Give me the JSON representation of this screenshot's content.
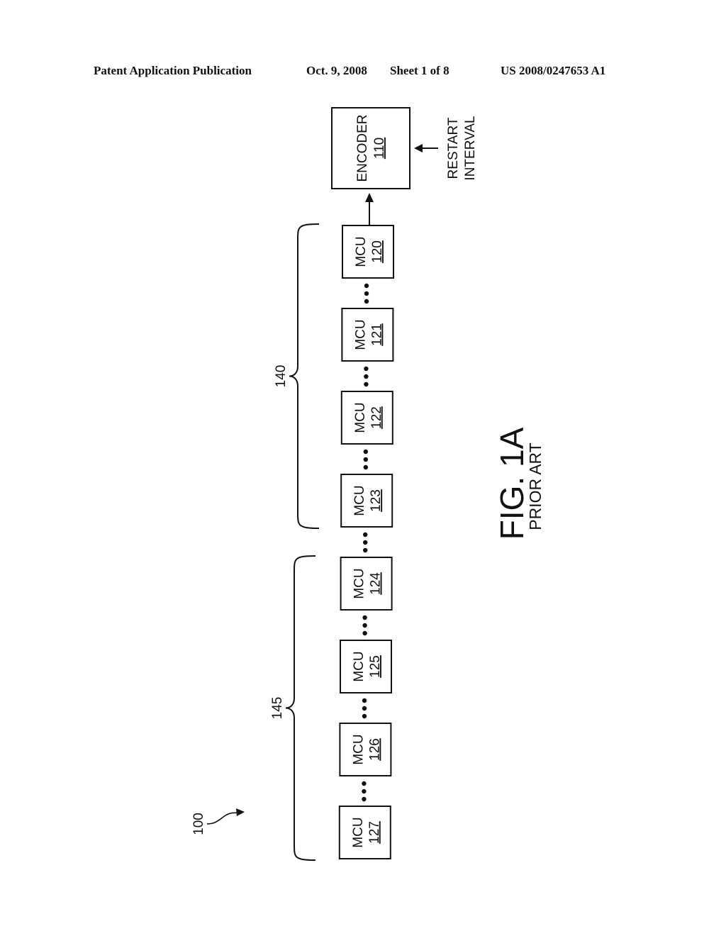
{
  "header": {
    "publication": "Patent Application Publication",
    "date": "Oct. 9, 2008",
    "sheet": "Sheet 1 of 8",
    "patent_number": "US 2008/0247653 A1"
  },
  "figure": {
    "label": "FIG. 1A",
    "sublabel": "PRIOR ART",
    "reference": "100"
  },
  "encoder": {
    "name": "ENCODER",
    "ref": "110",
    "input_label_line1": "RESTART",
    "input_label_line2": "INTERVAL"
  },
  "mcus": [
    {
      "name": "MCU",
      "ref": "120"
    },
    {
      "name": "MCU",
      "ref": "121"
    },
    {
      "name": "MCU",
      "ref": "122"
    },
    {
      "name": "MCU",
      "ref": "123"
    },
    {
      "name": "MCU",
      "ref": "124"
    },
    {
      "name": "MCU",
      "ref": "125"
    },
    {
      "name": "MCU",
      "ref": "126"
    },
    {
      "name": "MCU",
      "ref": "127"
    }
  ],
  "groups": [
    {
      "ref": "140",
      "members": [
        "120",
        "121",
        "122",
        "123"
      ]
    },
    {
      "ref": "145",
      "members": [
        "124",
        "125",
        "126",
        "127"
      ]
    }
  ]
}
